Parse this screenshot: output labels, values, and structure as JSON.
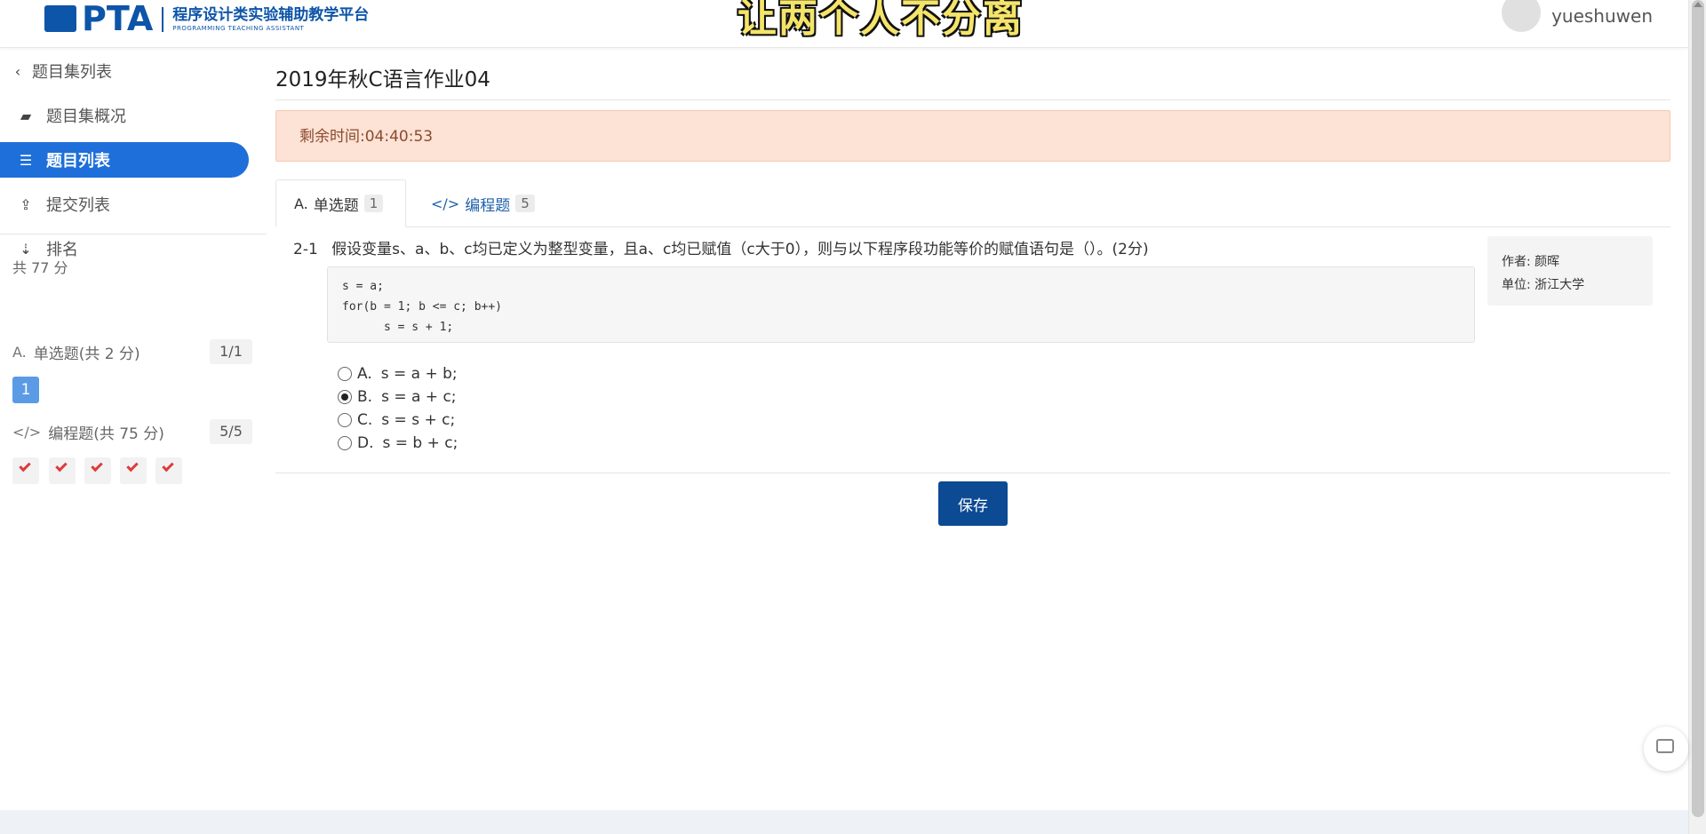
{
  "header": {
    "logo_text": "PTA",
    "logo_cn": "程序设计类实验辅助教学平台",
    "logo_en": "PROGRAMMING TEACHING ASSISTANT",
    "banner": "让两个人不分离",
    "username": "yueshuwen"
  },
  "sidebar": {
    "back_label": "题目集列表",
    "items": [
      {
        "label": "题目集概况",
        "icon": "book-icon"
      },
      {
        "label": "题目列表",
        "icon": "list-icon"
      },
      {
        "label": "提交列表",
        "icon": "upload-icon"
      },
      {
        "label": "排名",
        "icon": "sort-icon"
      }
    ],
    "total_score": "共 77 分",
    "sections": [
      {
        "label": "单选题(共 2 分)",
        "count": "1/1",
        "icon": "A."
      },
      {
        "label": "编程题(共 75 分)",
        "count": "5/5",
        "icon": "</>"
      }
    ],
    "single_questions": [
      "1"
    ]
  },
  "main": {
    "title": "2019年秋C语言作业04",
    "timer": "剩余时间:04:40:53",
    "tabs": [
      {
        "label": "单选题",
        "count": "1",
        "icon": "A."
      },
      {
        "label": "编程题",
        "count": "5",
        "icon": "</>"
      }
    ],
    "question": {
      "number": "2-1",
      "text": "假设变量s、a、b、c均已定义为整型变量，且a、c均已赋值（c大于0），则与以下程序段功能等价的赋值语句是（）。(2分)",
      "code": [
        "s = a;",
        "for(b = 1; b <= c; b++)",
        "      s = s + 1;"
      ],
      "author_label": "作者: 颜晖",
      "unit_label": "单位: 浙江大学",
      "options": [
        {
          "letter": "A.",
          "text": "s = a + b;"
        },
        {
          "letter": "B.",
          "text": "s = a + c;"
        },
        {
          "letter": "C.",
          "text": "s = s + c;"
        },
        {
          "letter": "D.",
          "text": "s = b + c;"
        }
      ],
      "selected": "B."
    },
    "save_label": "保存"
  },
  "colors": {
    "accent": "#1e6fd9",
    "save_button": "#0c4a93",
    "timer_bg": "#fde2d6",
    "check": "#e03a3a"
  }
}
